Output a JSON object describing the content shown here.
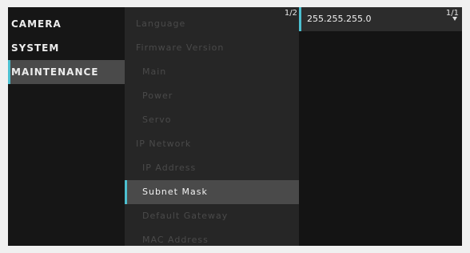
{
  "main_menu": {
    "items": [
      {
        "label": "CAMERA",
        "selected": false
      },
      {
        "label": "SYSTEM",
        "selected": false
      },
      {
        "label": "MAINTENANCE",
        "selected": true
      }
    ]
  },
  "sub_menu": {
    "page_indicator": "1/2",
    "items": [
      {
        "label": "Language",
        "indent": false
      },
      {
        "label": "Firmware Version",
        "indent": false
      },
      {
        "label": "Main",
        "indent": true
      },
      {
        "label": "Power",
        "indent": true
      },
      {
        "label": "Servo",
        "indent": true
      },
      {
        "label": "IP Network",
        "indent": false
      },
      {
        "label": "IP Address",
        "indent": true
      },
      {
        "label": "Subnet Mask",
        "indent": true,
        "selected": true
      },
      {
        "label": "Default Gateway",
        "indent": true
      },
      {
        "label": "MAC Address",
        "indent": true
      }
    ]
  },
  "value_panel": {
    "value": "255.255.255.0",
    "page_indicator": "1/1"
  },
  "colors": {
    "accent": "#4cc0d0",
    "selected_bg": "#4a4a4a"
  }
}
